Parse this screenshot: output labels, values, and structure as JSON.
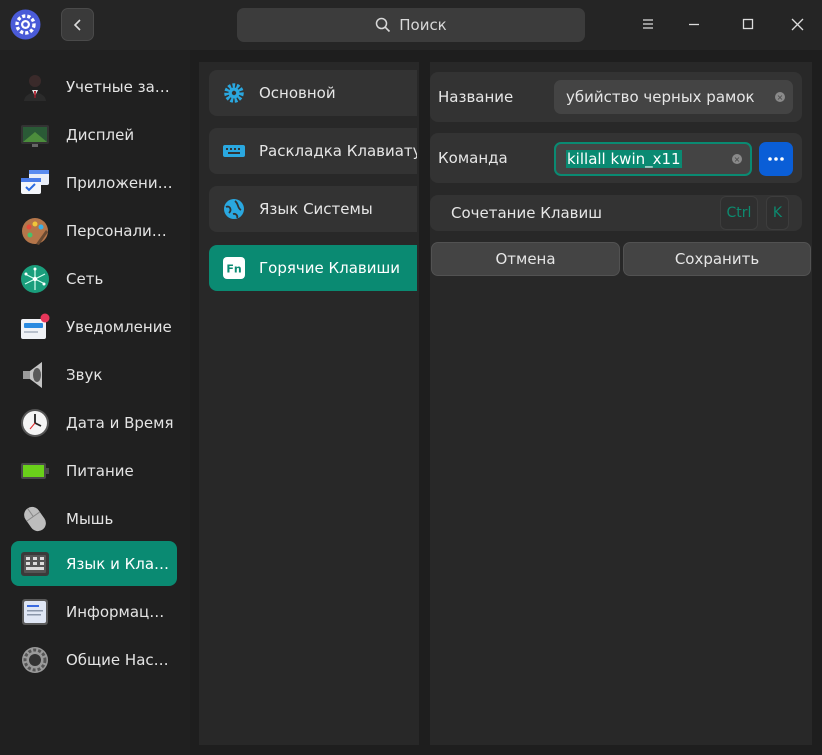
{
  "header": {
    "search_label": "Поиск"
  },
  "sidebar": {
    "items": [
      {
        "label": "Учетные запи...",
        "icon": "user-accounts-icon"
      },
      {
        "label": "Дисплей",
        "icon": "display-icon"
      },
      {
        "label": "Приложения ...",
        "icon": "default-apps-icon"
      },
      {
        "label": "Персонализа...",
        "icon": "personalization-icon"
      },
      {
        "label": "Сеть",
        "icon": "network-icon"
      },
      {
        "label": "Уведомление",
        "icon": "notification-icon"
      },
      {
        "label": "Звук",
        "icon": "sound-icon"
      },
      {
        "label": "Дата и Время",
        "icon": "clock-icon"
      },
      {
        "label": "Питание",
        "icon": "battery-icon"
      },
      {
        "label": "Мышь",
        "icon": "mouse-icon"
      },
      {
        "label": "Язык и  Клави...",
        "icon": "keyboard-icon"
      },
      {
        "label": "Информация ...",
        "icon": "system-info-icon"
      },
      {
        "label": "Общие Настр...",
        "icon": "general-settings-icon"
      }
    ],
    "active_index": 10
  },
  "subnav": {
    "items": [
      {
        "label": "Основной",
        "icon": "gear-icon"
      },
      {
        "label": "Раскладка Клавиатуры",
        "icon": "keyboard-layout-icon"
      },
      {
        "label": "Язык Системы",
        "icon": "globe-icon"
      },
      {
        "label": "Горячие Клавиши",
        "icon": "fn-key-icon"
      }
    ],
    "active_index": 3
  },
  "form": {
    "name_label": "Название",
    "name_value": "убийство черных рамок",
    "command_label": "Команда",
    "command_value": "killall kwin_x11",
    "shortcut_label": "Сочетание Клавиш",
    "shortcut_keys": [
      "Ctrl",
      "K"
    ],
    "cancel_label": "Отмена",
    "save_label": "Сохранить"
  },
  "colors": {
    "accent": "#0a8a72",
    "button_blue": "#0a5ed7"
  }
}
